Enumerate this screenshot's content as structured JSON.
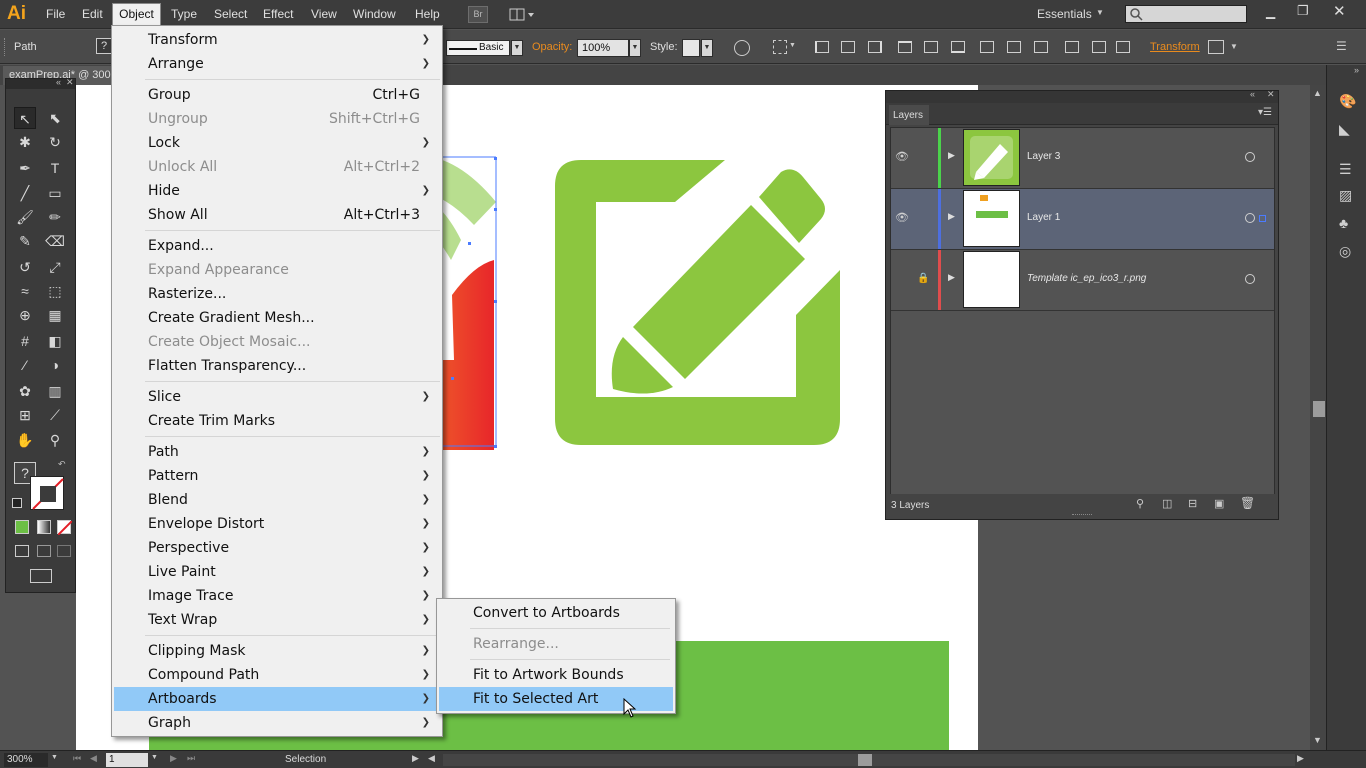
{
  "app": {
    "logo": "Ai"
  },
  "menubar": {
    "items": [
      "File",
      "Edit",
      "Object",
      "Type",
      "Select",
      "Effect",
      "View",
      "Window",
      "Help"
    ],
    "bridge_label": "Br",
    "workspace": "Essentials",
    "search_placeholder": ""
  },
  "controlbar": {
    "selection_type": "Path",
    "stroke_profile": "Basic",
    "opacity_label": "Opacity:",
    "opacity_value": "100%",
    "style_label": "Style:",
    "transform_label": "Transform"
  },
  "document": {
    "tab_title": "examPrep.ai* @ 300"
  },
  "object_menu": {
    "items": [
      {
        "label": "Transform",
        "submenu": true
      },
      {
        "label": "Arrange",
        "submenu": true
      },
      {
        "label": "Group",
        "shortcut": "Ctrl+G"
      },
      {
        "label": "Ungroup",
        "shortcut": "Shift+Ctrl+G",
        "disabled": true
      },
      {
        "label": "Lock",
        "submenu": true
      },
      {
        "label": "Unlock All",
        "shortcut": "Alt+Ctrl+2",
        "disabled": true
      },
      {
        "label": "Hide",
        "submenu": true
      },
      {
        "label": "Show All",
        "shortcut": "Alt+Ctrl+3"
      },
      {
        "label": "Expand..."
      },
      {
        "label": "Expand Appearance",
        "disabled": true
      },
      {
        "label": "Rasterize..."
      },
      {
        "label": "Create Gradient Mesh..."
      },
      {
        "label": "Create Object Mosaic...",
        "disabled": true
      },
      {
        "label": "Flatten Transparency..."
      },
      {
        "label": "Slice",
        "submenu": true
      },
      {
        "label": "Create Trim Marks"
      },
      {
        "label": "Path",
        "submenu": true
      },
      {
        "label": "Pattern",
        "submenu": true
      },
      {
        "label": "Blend",
        "submenu": true
      },
      {
        "label": "Envelope Distort",
        "submenu": true
      },
      {
        "label": "Perspective",
        "submenu": true
      },
      {
        "label": "Live Paint",
        "submenu": true
      },
      {
        "label": "Image Trace",
        "submenu": true
      },
      {
        "label": "Text Wrap",
        "submenu": true
      },
      {
        "label": "Clipping Mask",
        "submenu": true
      },
      {
        "label": "Compound Path",
        "submenu": true
      },
      {
        "label": "Artboards",
        "submenu": true,
        "highlighted": true
      },
      {
        "label": "Graph",
        "submenu": true
      }
    ]
  },
  "artboards_submenu": {
    "items": [
      {
        "label": "Convert to Artboards"
      },
      {
        "label": "Rearrange...",
        "disabled": true
      },
      {
        "label": "Fit to Artwork Bounds"
      },
      {
        "label": "Fit to Selected Art",
        "highlighted": true
      }
    ]
  },
  "layers_panel": {
    "title": "Layers",
    "layers": [
      {
        "name": "Layer 3",
        "color": "#4bd34b",
        "visible": true,
        "locked": false,
        "selected": false
      },
      {
        "name": "Layer 1",
        "color": "#4d6fe0",
        "visible": true,
        "locked": false,
        "selected": true
      },
      {
        "name": "Template ic_ep_ico3_r.png",
        "color": "#e04d4d",
        "visible": false,
        "locked": true,
        "selected": false
      }
    ],
    "count_label": "3 Layers"
  },
  "statusbar": {
    "zoom": "300%",
    "artboard_number": "1",
    "tool_name": "Selection"
  },
  "colors": {
    "icon_green": "#8cc63f",
    "bar_green": "#6cbf45",
    "accent_orange": "#e98b1e",
    "menu_highlight": "#91c9f7"
  }
}
